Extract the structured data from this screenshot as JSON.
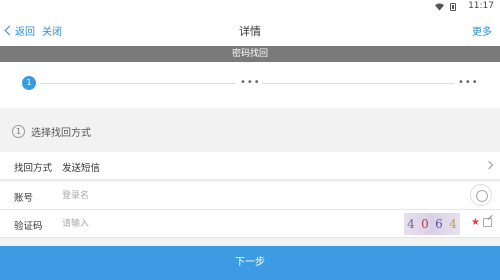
{
  "status_bar": {
    "time": "11:17"
  },
  "navbar": {
    "back_label": "返回",
    "close_label": "关闭",
    "title": "详情",
    "more_label": "更多"
  },
  "section_title": "密码找回",
  "steps": {
    "current": "1",
    "dots": "•••"
  },
  "sub_header": {
    "number": "1",
    "text": "选择找回方式"
  },
  "form": {
    "method": {
      "label": "找回方式",
      "value": "发送短信"
    },
    "account": {
      "label": "账号",
      "placeholder": "登录名"
    },
    "captcha": {
      "label": "验证码",
      "placeholder": "请输入",
      "chars": [
        "4",
        "0",
        "6",
        "4"
      ],
      "required_mark": "★"
    }
  },
  "next_button": "下一步",
  "colors": {
    "accent": "#3d9be3",
    "band": "#7a7a7a",
    "required": "#e04040"
  }
}
